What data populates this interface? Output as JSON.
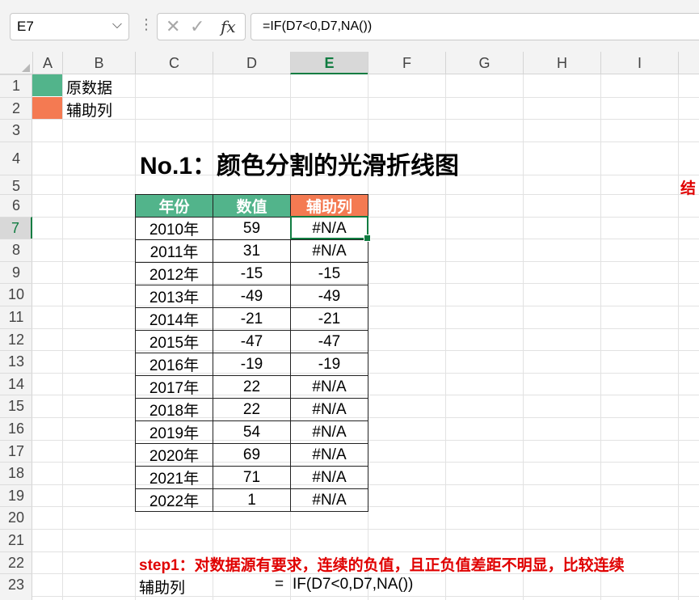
{
  "formula_bar": {
    "name_box": "E7",
    "formula": "=IF(D7<0,D7,NA())"
  },
  "columns": [
    "A",
    "B",
    "C",
    "D",
    "E",
    "F",
    "G",
    "H",
    "I"
  ],
  "rows": [
    "1",
    "2",
    "3",
    "4",
    "5",
    "6",
    "7",
    "8",
    "9",
    "10",
    "11",
    "12",
    "13",
    "14",
    "15",
    "16",
    "17",
    "18",
    "19",
    "20",
    "21",
    "22",
    "23"
  ],
  "legend": {
    "items": [
      {
        "label": "原数据",
        "color": "#52b48b"
      },
      {
        "label": "辅助列",
        "color": "#f47a52"
      }
    ]
  },
  "title": "No.1：颜色分割的光滑折线图",
  "cut_text": "结",
  "table": {
    "headers": [
      "年份",
      "数值",
      "辅助列"
    ],
    "rows": [
      [
        "2010年",
        "59",
        "#N/A"
      ],
      [
        "2011年",
        "31",
        "#N/A"
      ],
      [
        "2012年",
        "-15",
        "-15"
      ],
      [
        "2013年",
        "-49",
        "-49"
      ],
      [
        "2014年",
        "-21",
        "-21"
      ],
      [
        "2015年",
        "-47",
        "-47"
      ],
      [
        "2016年",
        "-19",
        "-19"
      ],
      [
        "2017年",
        "22",
        "#N/A"
      ],
      [
        "2018年",
        "22",
        "#N/A"
      ],
      [
        "2019年",
        "54",
        "#N/A"
      ],
      [
        "2020年",
        "69",
        "#N/A"
      ],
      [
        "2021年",
        "71",
        "#N/A"
      ],
      [
        "2022年",
        "1",
        "#N/A"
      ]
    ]
  },
  "step1": "step1：对数据源有要求，连续的负值，且正负值差距不明显，比较连续",
  "helper": {
    "label": "辅助列",
    "eq": "=",
    "formula": "IF(D7<0,D7,NA())"
  },
  "colors": {
    "accent_green": "#107c41",
    "header_green": "#52b48b",
    "header_orange": "#f47a52",
    "red_text": "#e00000"
  }
}
